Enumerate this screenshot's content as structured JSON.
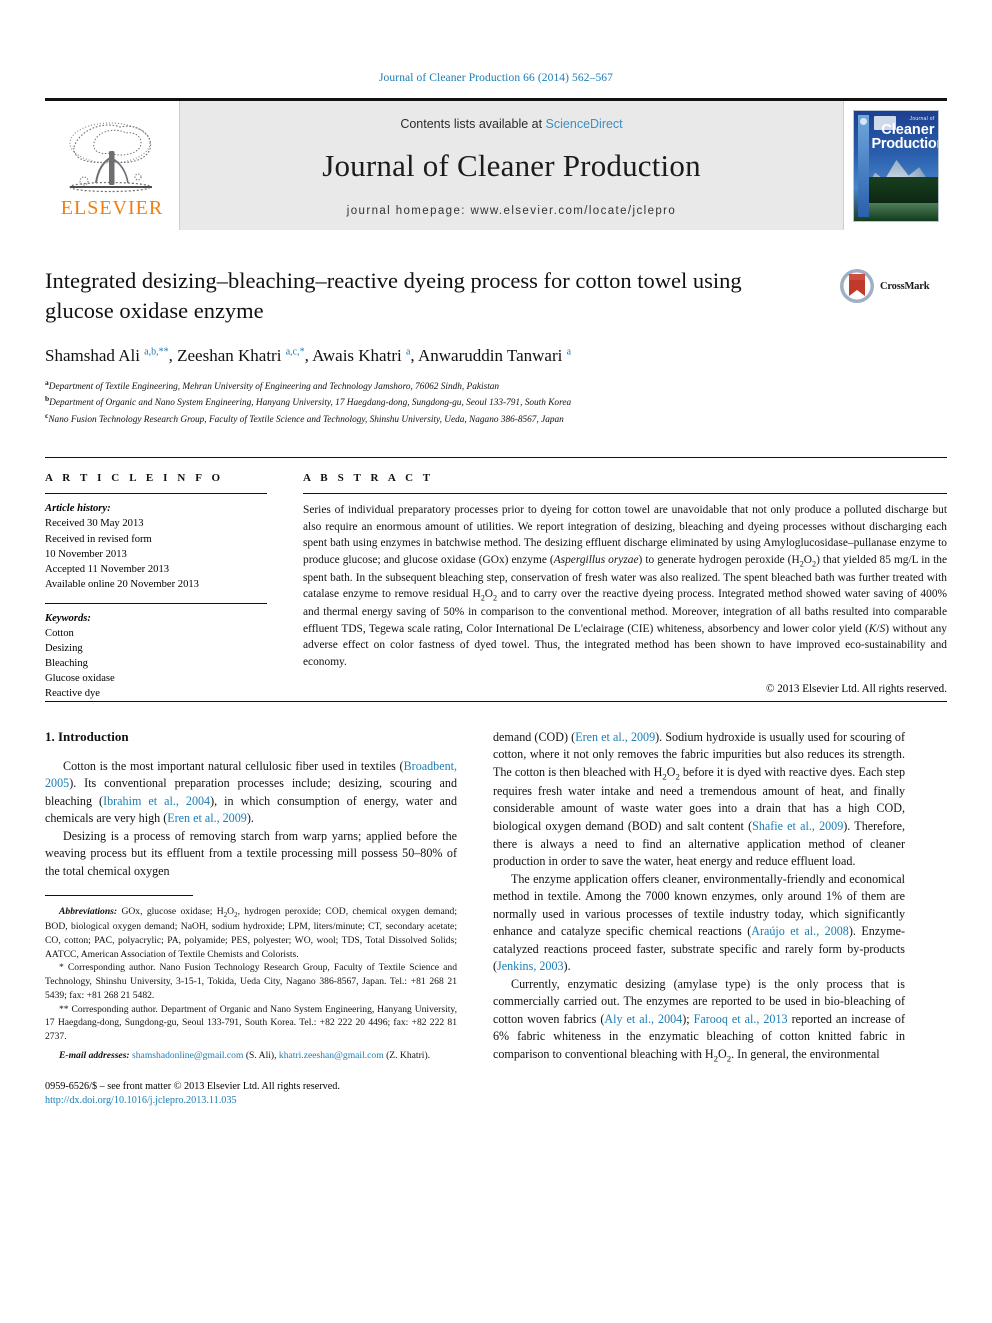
{
  "running_head": "Journal of Cleaner Production 66 (2014) 562–567",
  "masthead": {
    "elsevier_wordmark": "ELSEVIER",
    "contents_prefix": "Contents lists available at ",
    "contents_link": "ScienceDirect",
    "journal_name": "Journal of Cleaner Production",
    "homepage": "journal homepage: www.elsevier.com/locate/jclepro",
    "cover": {
      "small_line": "Journal of",
      "big_line1": "Cleaner",
      "big_line2": "Production"
    }
  },
  "article": {
    "title": "Integrated desizing–bleaching–reactive dyeing process for cotton towel using glucose oxidase enzyme",
    "authors_html": "Shamshad Ali <sup>a,b,**</sup>, Zeeshan Khatri <sup>a,c,*</sup>, Awais Khatri <sup>a</sup>, Anwaruddin Tanwari <sup>a</sup>",
    "affiliations": [
      "Department of Textile Engineering, Mehran University of Engineering and Technology Jamshoro, 76062 Sindh, Pakistan",
      "Department of Organic and Nano System Engineering, Hanyang University, 17 Haegdang-dong, Sungdong-gu, Seoul 133-791, South Korea",
      "Nano Fusion Technology Research Group, Faculty of Textile Science and Technology, Shinshu University, Ueda, Nagano 386-8567, Japan"
    ],
    "affiliation_marks": [
      "a",
      "b",
      "c"
    ],
    "crossmark_label": "CrossMark"
  },
  "article_info": {
    "heading": "A R T I C L E  I N F O",
    "history_label": "Article history:",
    "history": [
      "Received 30 May 2013",
      "Received in revised form",
      "10 November 2013",
      "Accepted 11 November 2013",
      "Available online 20 November 2013"
    ],
    "keywords_label": "Keywords:",
    "keywords": [
      "Cotton",
      "Desizing",
      "Bleaching",
      "Glucose oxidase",
      "Reactive dye"
    ]
  },
  "abstract": {
    "heading": "A B S T R A C T",
    "text_html": "Series of individual preparatory processes prior to dyeing for cotton towel are unavoidable that not only produce a polluted discharge but also require an enormous amount of utilities. We report integration of desizing, bleaching and dyeing processes without discharging each spent bath using enzymes in batchwise method. The desizing effluent discharge eliminated by using Amyloglucosidase–pullanase enzyme to produce glucose; and glucose oxidase (GOx) enzyme (<i>Aspergillus oryzae</i>) to generate hydrogen peroxide (H<sub>2</sub>O<sub>2</sub>) that yielded 85 mg/L in the spent bath. In the subsequent bleaching step, conservation of fresh water was also realized. The spent bleached bath was further treated with catalase enzyme to remove residual H<sub>2</sub>O<sub>2</sub> and to carry over the reactive dyeing process. Integrated method showed water saving of 400% and thermal energy saving of 50% in comparison to the conventional method. Moreover, integration of all baths resulted into comparable effluent TDS, Tegewa scale rating, Color International De L'eclairage (CIE) whiteness, absorbency and lower color yield (<i>K</i>/<i>S</i>) without any adverse effect on color fastness of dyed towel. Thus, the integrated method has been shown to have improved eco-sustainability and economy.",
    "copyright": "© 2013 Elsevier Ltd. All rights reserved."
  },
  "body": {
    "section_heading": "1. Introduction",
    "left_paragraphs_html": [
      "Cotton is the most important natural cellulosic fiber used in textiles (<span class=\"ref\">Broadbent, 2005</span>). Its conventional preparation processes include; desizing, scouring and bleaching (<span class=\"ref\">Ibrahim et al., 2004</span>), in which consumption of energy, water and chemicals are very high (<span class=\"ref\">Eren et al., 2009</span>).",
      "Desizing is a process of removing starch from warp yarns; applied before the weaving process but its effluent from a textile processing mill possess 50–80% of the total chemical oxygen"
    ],
    "right_paragraphs_html": [
      "demand (COD) (<span class=\"ref\">Eren et al., 2009</span>). Sodium hydroxide is usually used for scouring of cotton, where it not only removes the fabric impurities but also reduces its strength. The cotton is then bleached with H<sub>2</sub>O<sub>2</sub> before it is dyed with reactive dyes. Each step requires fresh water intake and need a tremendous amount of heat, and finally considerable amount of waste water goes into a drain that has a high COD, biological oxygen demand (BOD) and salt content (<span class=\"ref\">Shafie et al., 2009</span>). Therefore, there is always a need to find an alternative application method of cleaner production in order to save the water, heat energy and reduce effluent load.",
      "The enzyme application offers cleaner, environmentally-friendly and economical method in textile. Among the 7000 known enzymes, only around 1% of them are normally used in various processes of textile industry today, which significantly enhance and catalyze specific chemical reactions (<span class=\"ref\">Araújo et al., 2008</span>). Enzyme-catalyzed reactions proceed faster, substrate specific and rarely form by-products (<span class=\"ref\">Jenkins, 2003</span>).",
      "Currently, enzymatic desizing (amylase type) is the only process that is commercially carried out. The enzymes are reported to be used in bio-bleaching of cotton woven fabrics (<span class=\"ref\">Aly et al., 2004</span>); <span class=\"ref\">Farooq et al., 2013</span> reported an increase of 6% fabric whiteness in the enzymatic bleaching of cotton knitted fabric in comparison to conventional bleaching with H<sub>2</sub>O<sub>2</sub>. In general, the environmental"
    ]
  },
  "footnotes": {
    "abbreviations_html": "<span class=\"lead\">Abbreviations:</span> GOx, glucose oxidase; H<sub>2</sub>O<sub>2</sub>, hydrogen peroxide; COD, chemical oxygen demand; BOD, biological oxygen demand; NaOH, sodium hydroxide; LPM, liters/minute; CT, secondary acetate; CO, cotton; PAC, polyacrylic; PA, polyamide; PES, polyester; WO, wool; TDS, Total Dissolved Solids; AATCC, American Association of Textile Chemists and Colorists.",
    "corresponding_1": "* Corresponding author. Nano Fusion Technology Research Group, Faculty of Textile Science and Technology, Shinshu University, 3-15-1, Tokida, Ueda City, Nagano 386-8567, Japan. Tel.: +81 268 21 5439; fax: +81 268 21 5482.",
    "corresponding_2": "** Corresponding author. Department of Organic and Nano System Engineering, Hanyang University, 17 Haegdang-dong, Sungdong-gu, Seoul 133-791, South Korea. Tel.: +82 222 20 4496; fax: +82 222 81 2737.",
    "email_label": "E-mail addresses:",
    "email_1": "shamshadonline@gmail.com",
    "email_1_owner": "(S. Ali),",
    "email_2": "khatri.zeeshan@gmail.com",
    "email_2_owner": "(Z. Khatri)."
  },
  "colophon": {
    "issn_line": "0959-6526/$ – see front matter © 2013 Elsevier Ltd. All rights reserved.",
    "doi": "http://dx.doi.org/10.1016/j.jclepro.2013.11.035"
  }
}
